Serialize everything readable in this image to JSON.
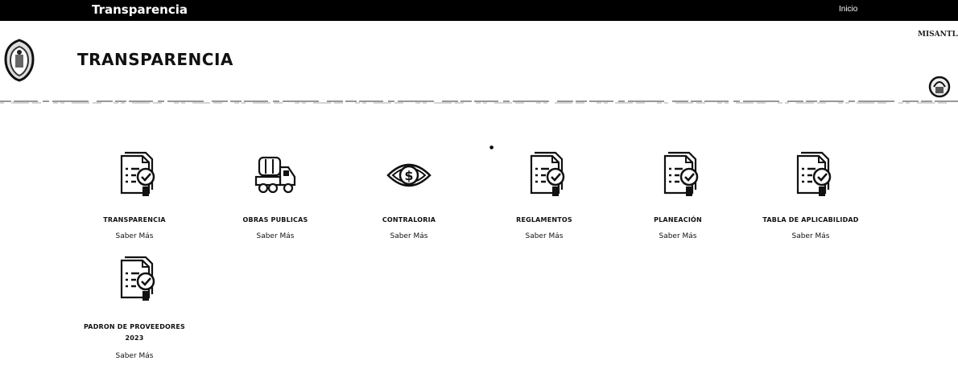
{
  "topbar": {
    "site_title": "Transparencia",
    "nav_home": "Inicio"
  },
  "header": {
    "title": "TRANSPARENCIA",
    "brand_text": "MISANTLA"
  },
  "cards": [
    {
      "label": "TRANSPARENCIA",
      "link": "Saber Más",
      "icon": "document-check-icon"
    },
    {
      "label": "OBRAS PUBLICAS",
      "link": "Saber Más",
      "icon": "truck-icon"
    },
    {
      "label": "CONTRALORIA",
      "link": "Saber Más",
      "icon": "eye-dollar-icon"
    },
    {
      "label": "REGLAMENTOS",
      "link": "Saber Más",
      "icon": "document-check-icon"
    },
    {
      "label": "PLANEACIÓN",
      "link": "Saber Más",
      "icon": "document-check-icon"
    },
    {
      "label": "TABLA DE APLICABILIDAD",
      "link": "Saber Más",
      "icon": "document-check-icon"
    },
    {
      "label": "PADRON DE PROVEEDORES",
      "label_line2": "2023",
      "link": "Saber Más",
      "icon": "document-check-icon"
    }
  ]
}
